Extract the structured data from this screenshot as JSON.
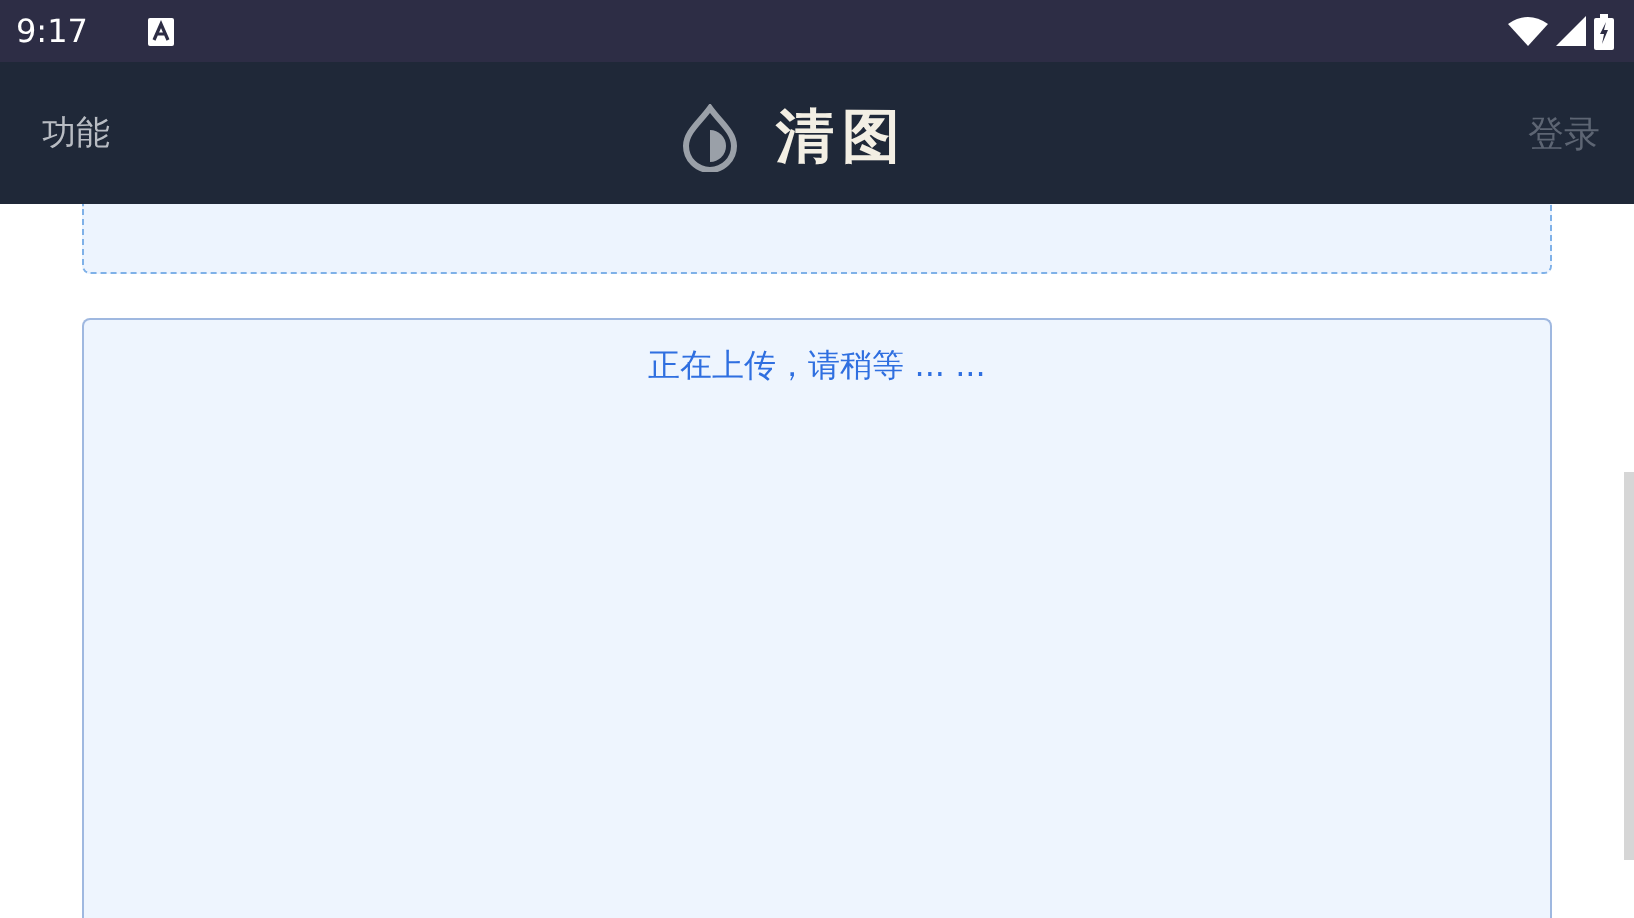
{
  "status_bar": {
    "time": "9:17"
  },
  "header": {
    "menu_label": "功能",
    "title": "清图",
    "login_label": "登录"
  },
  "upload_panel": {
    "message": "正在上传，请稍等 ... ..."
  }
}
